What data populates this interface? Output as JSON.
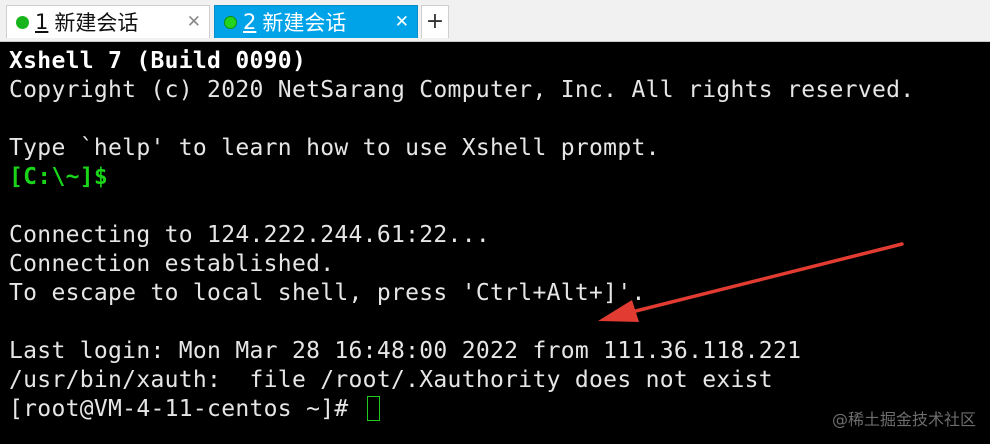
{
  "tabs": [
    {
      "number": "1",
      "label": "新建会话",
      "close": "✕",
      "status": "connected"
    },
    {
      "number": "2",
      "label": "新建会话",
      "close": "✕",
      "status": "connected"
    }
  ],
  "tab_add_label": "+",
  "terminal": {
    "lines": [
      "Xshell 7 (Build 0090)",
      "Copyright (c) 2020 NetSarang Computer, Inc. All rights reserved.",
      "",
      "Type `help' to learn how to use Xshell prompt.",
      "[C:\\~]$",
      "",
      "Connecting to 124.222.244.61:22...",
      "Connection established.",
      "To escape to local shell, press 'Ctrl+Alt+]'.",
      "",
      "Last login: Mon Mar 28 16:48:00 2022 from 111.36.118.221",
      "/usr/bin/xauth:  file /root/.Xauthority does not exist",
      "[root@VM-4-11-centos ~]# "
    ]
  },
  "watermark": "@稀土掘金技术社区",
  "colors": {
    "terminal_bg": "#000000",
    "terminal_fg": "#e6e6e6",
    "prompt_green": "#19d419",
    "active_tab": "#00a2e8",
    "status_dot": "#17b51b",
    "annotation_arrow": "#e23c32"
  },
  "icons": {
    "status": "green-dot-icon",
    "close": "close-icon",
    "add": "plus-icon",
    "annotation": "red-arrow-icon"
  }
}
